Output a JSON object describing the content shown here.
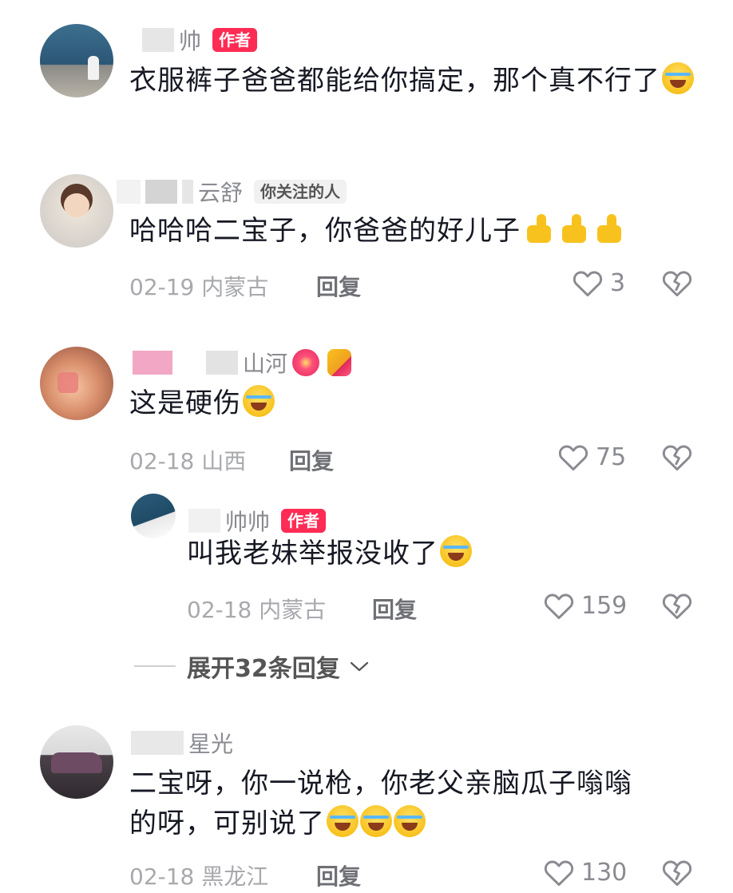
{
  "comments": [
    {
      "username": "帅",
      "badge": "作者",
      "text": "衣服裤子爸爸都能给你搞定，那个真不行了",
      "emoji": "laugh"
    },
    {
      "username": "云舒",
      "badge": "你关注的人",
      "text": "哈哈哈二宝子，你爸爸的好儿子",
      "emoji": "thumbs-up x3",
      "date": "02-19",
      "location": "内蒙古",
      "reply_label": "回复",
      "likes": "3"
    },
    {
      "username": "山河",
      "text": "这是硬伤",
      "emoji": "laugh",
      "date": "02-18",
      "location": "山西",
      "reply_label": "回复",
      "likes": "75"
    },
    {
      "username": "帅帅",
      "badge": "作者",
      "text": "叫我老妹举报没收了",
      "emoji": "laugh",
      "date": "02-18",
      "location": "内蒙古",
      "reply_label": "回复",
      "likes": "159"
    },
    {
      "username": "星光",
      "text_line1": "二宝呀，你一说枪，你老父亲脑瓜子嗡嗡",
      "text_line2": "的呀，可别说了",
      "emoji": "crying x3",
      "date": "02-18",
      "location": "黑龙江",
      "reply_label": "回复",
      "likes": "130"
    }
  ],
  "expand_replies": "展开32条回复",
  "colors": {
    "author_badge": "#fe2c55",
    "text": "#161823",
    "meta": "#a8a9ad",
    "username": "#8a8b91"
  },
  "icons": [
    "heart-icon",
    "dislike-icon",
    "chevron-down-icon"
  ]
}
